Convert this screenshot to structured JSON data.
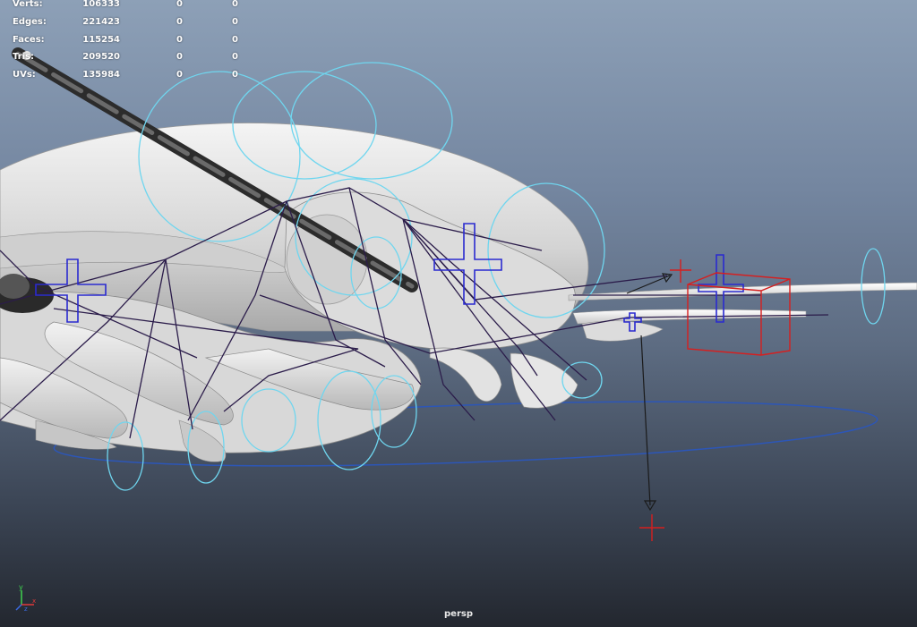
{
  "viewport": {
    "camera": "persp",
    "background_top": "#8da0b7",
    "background_bottom": "#23272f"
  },
  "hud": {
    "rows": [
      {
        "label": "Verts:",
        "v1": "106333",
        "v2": "0",
        "v3": "0"
      },
      {
        "label": "Edges:",
        "v1": "221423",
        "v2": "0",
        "v3": "0"
      },
      {
        "label": "Faces:",
        "v1": "115254",
        "v2": "0",
        "v3": "0"
      },
      {
        "label": "Tris:",
        "v1": "209520",
        "v2": "0",
        "v3": "0"
      },
      {
        "label": "UVs:",
        "v1": "135984",
        "v2": "0",
        "v3": "0"
      }
    ]
  },
  "axis": {
    "y_label": "y",
    "x_label": "x",
    "z_label": "z"
  },
  "colors": {
    "ik_circle": "#6fd6ef",
    "joint_line": "#2b1c4a",
    "locator_blue": "#2a2ad0",
    "selected_red": "#d61f1f",
    "floor_circle": "#2c56b8"
  }
}
